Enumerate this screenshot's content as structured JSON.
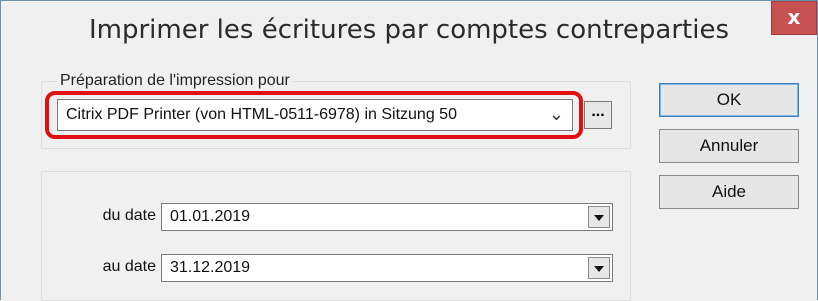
{
  "window": {
    "title": "Imprimer les écritures par comptes contreparties",
    "close_label": "x"
  },
  "print_prep": {
    "legend": "Préparation de l'impression pour",
    "printer_value": "Citrix PDF Printer (von HTML-0511-6978) in Sitzung 50",
    "chevron": "⌄",
    "browse_label": "..."
  },
  "buttons": {
    "ok": "OK",
    "cancel": "Annuler",
    "help": "Aide"
  },
  "dates": {
    "from_label": "du date",
    "from_value": "01.01.2019",
    "to_label": "au date",
    "to_value": "31.12.2019"
  },
  "colors": {
    "highlight": "#e01010",
    "close_button": "#c75050"
  }
}
